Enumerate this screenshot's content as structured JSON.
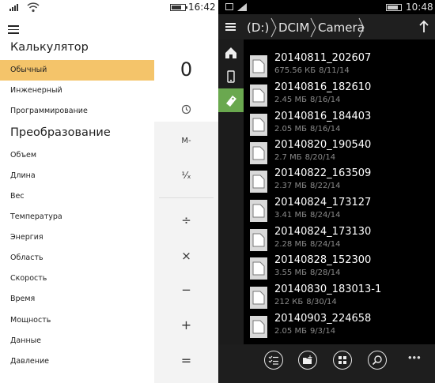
{
  "left": {
    "status": {
      "time": "16:42"
    },
    "menu": {
      "title": "Калькулятор",
      "calc_items": [
        {
          "label": "Обычный",
          "active": true
        },
        {
          "label": "Инженерный"
        },
        {
          "label": "Программирование"
        }
      ],
      "conversion_title": "Преобразование",
      "conversion_items": [
        {
          "label": "Объем"
        },
        {
          "label": "Длина"
        },
        {
          "label": "Вес"
        },
        {
          "label": "Температура"
        },
        {
          "label": "Энергия"
        },
        {
          "label": "Область"
        },
        {
          "label": "Скорость"
        },
        {
          "label": "Время"
        },
        {
          "label": "Мощность"
        },
        {
          "label": "Данные"
        },
        {
          "label": "Давление"
        }
      ]
    },
    "calculator": {
      "display": "0",
      "keys": {
        "memory_minus": "M-",
        "reciprocal": "¹⁄ₓ",
        "divide": "÷",
        "multiply": "×",
        "subtract": "−",
        "add": "+",
        "equals": "="
      }
    }
  },
  "right": {
    "status": {
      "time": "10:48"
    },
    "path": [
      "(D:)",
      "DCIM",
      "Camera"
    ],
    "files": [
      {
        "name": "20140811_202607",
        "size": "675.56 КБ",
        "date": "8/11/14"
      },
      {
        "name": "20140816_182610",
        "size": "2.45 МБ",
        "date": "8/16/14"
      },
      {
        "name": "20140816_184403",
        "size": "2.05 МБ",
        "date": "8/16/14"
      },
      {
        "name": "20140820_190540",
        "size": "2.7 МБ",
        "date": "8/20/14"
      },
      {
        "name": "20140822_163509",
        "size": "2.37 МБ",
        "date": "8/22/14"
      },
      {
        "name": "20140824_173127",
        "size": "3.41 МБ",
        "date": "8/24/14"
      },
      {
        "name": "20140824_173130",
        "size": "2.28 МБ",
        "date": "8/24/14"
      },
      {
        "name": "20140828_152300",
        "size": "3.55 МБ",
        "date": "8/28/14"
      },
      {
        "name": "20140830_183013-1",
        "size": "212 КБ",
        "date": "8/30/14"
      },
      {
        "name": "20140903_224658",
        "size": "2.05 МБ",
        "date": "9/3/14"
      }
    ],
    "appbar": {
      "more": "•••"
    },
    "accent": "#6aa84f"
  }
}
